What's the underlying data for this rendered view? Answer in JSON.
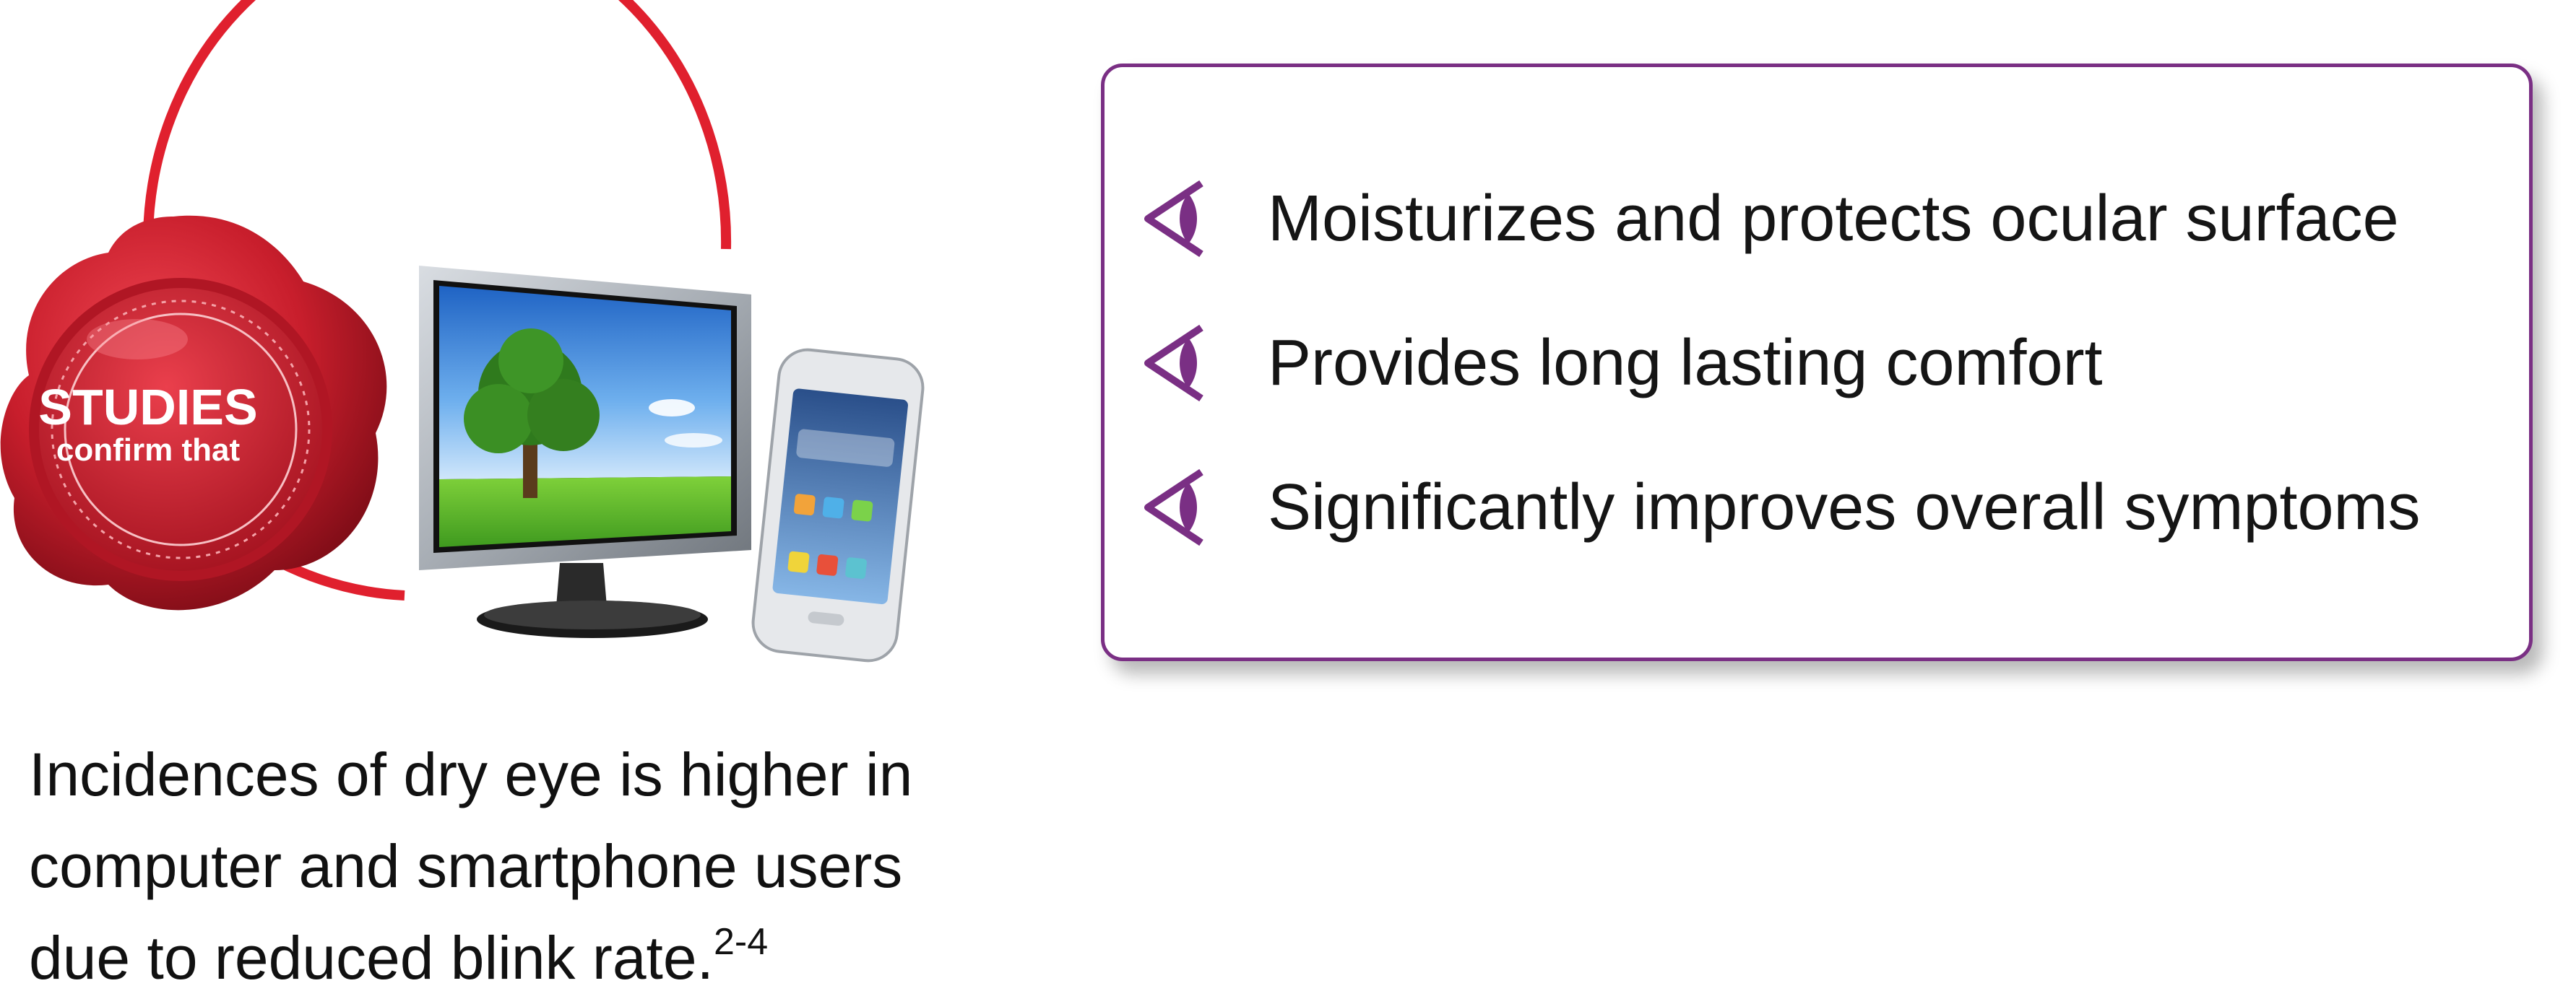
{
  "seal": {
    "line1": "STUDIES",
    "line2": "confirm that"
  },
  "benefits": [
    {
      "icon": "eye-arrow-icon",
      "text": "Moisturizes and protects ocular surface"
    },
    {
      "icon": "eye-arrow-icon",
      "text": "Provides long lasting comfort"
    },
    {
      "icon": "eye-arrow-icon",
      "text": "Significantly improves overall symptoms"
    }
  ],
  "caption": {
    "line1": "Incidences of dry eye is higher in",
    "line2": "computer and smartphone users",
    "line3": "due to reduced blink rate.",
    "reference": "2-4"
  },
  "colors": {
    "seal_red": "#d21f2f",
    "arc_red": "#e0202e",
    "accent_purple": "#7a2f84",
    "sky_blue": "#2f7fd6",
    "grass_green": "#5cb82f"
  }
}
